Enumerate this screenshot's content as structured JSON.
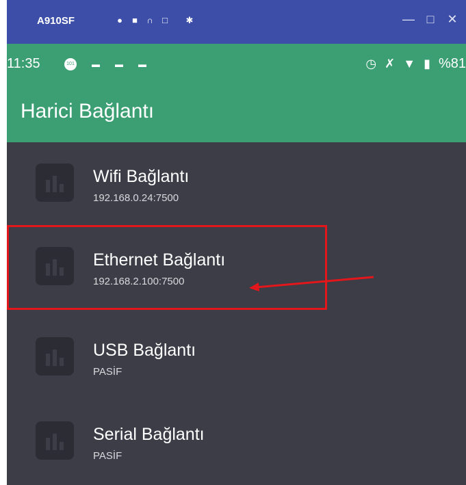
{
  "window": {
    "title": "A910SF",
    "toolbar_icons": [
      "camera-icon",
      "video-icon",
      "headset-icon",
      "fullscreen-icon",
      "settings-icon"
    ],
    "controls": [
      "minimize",
      "maximize",
      "close"
    ]
  },
  "statusbar": {
    "time": "11:35",
    "battery": "%81"
  },
  "appbar": {
    "title": "Harici Bağlantı"
  },
  "items": [
    {
      "label": "Wifi Bağlantı",
      "sub": "192.168.0.24:7500"
    },
    {
      "label": "Ethernet Bağlantı",
      "sub": "192.168.2.100:7500"
    },
    {
      "label": "USB Bağlantı",
      "sub": "PASİF"
    },
    {
      "label": "Serial Bağlantı",
      "sub": "PASİF"
    }
  ],
  "colors": {
    "titlebar": "#3c4ea8",
    "accent": "#3b9f73",
    "list_bg": "#3d3d47",
    "annotation": "#e3161b"
  }
}
